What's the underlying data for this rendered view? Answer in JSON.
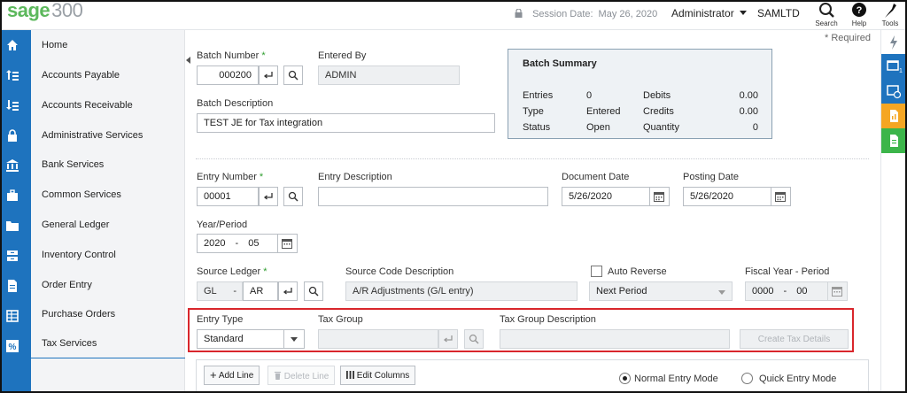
{
  "app": {
    "logo": "sage",
    "logo_version": "300"
  },
  "header": {
    "session_label": "Session Date:",
    "session_date": "May 26, 2020",
    "user": "Administrator",
    "company": "SAMLTD",
    "actions": [
      {
        "label": "Search",
        "icon": "search-icon"
      },
      {
        "label": "Help",
        "icon": "help-icon"
      },
      {
        "label": "Tools",
        "icon": "tools-icon"
      }
    ]
  },
  "sidebar": {
    "items": [
      {
        "label": "Home",
        "icon": "home-icon"
      },
      {
        "label": "Accounts Payable",
        "icon": "accounts-payable-icon"
      },
      {
        "label": "Accounts Receivable",
        "icon": "accounts-receivable-icon"
      },
      {
        "label": "Administrative Services",
        "icon": "lock-icon"
      },
      {
        "label": "Bank Services",
        "icon": "bank-icon"
      },
      {
        "label": "Common Services",
        "icon": "briefcase-icon"
      },
      {
        "label": "General Ledger",
        "icon": "folder-icon"
      },
      {
        "label": "Inventory Control",
        "icon": "inventory-icon"
      },
      {
        "label": "Order Entry",
        "icon": "document-icon"
      },
      {
        "label": "Purchase Orders",
        "icon": "grid-icon"
      },
      {
        "label": "Tax Services",
        "icon": "percent-icon"
      }
    ]
  },
  "form": {
    "required_note": "* Required",
    "batch_number": {
      "label": "Batch Number",
      "required": "*",
      "value": "000200"
    },
    "entered_by": {
      "label": "Entered By",
      "value": "ADMIN"
    },
    "batch_description": {
      "label": "Batch Description",
      "value": "TEST JE for Tax integration"
    },
    "entry_number": {
      "label": "Entry Number",
      "required": "*",
      "value": "00001"
    },
    "entry_description": {
      "label": "Entry Description",
      "value": ""
    },
    "document_date": {
      "label": "Document Date",
      "value": "5/26/2020"
    },
    "posting_date": {
      "label": "Posting Date",
      "value": "5/26/2020"
    },
    "year_period": {
      "label": "Year/Period",
      "year": "2020",
      "separator": "-",
      "period": "05"
    },
    "source_ledger": {
      "label": "Source Ledger",
      "required": "*",
      "ledger": "GL",
      "separator": "-",
      "type": "AR"
    },
    "source_code_description": {
      "label": "Source Code Description",
      "value": "A/R Adjustments (G/L entry)"
    },
    "auto_reverse": {
      "label": "Auto Reverse",
      "checked": false,
      "selected": "Next Period"
    },
    "fiscal_year_period": {
      "label": "Fiscal Year - Period",
      "year": "0000",
      "separator": "-",
      "period": "00"
    },
    "entry_type": {
      "label": "Entry Type",
      "selected": "Standard"
    },
    "tax_group": {
      "label": "Tax Group",
      "value": ""
    },
    "tax_group_description": {
      "label": "Tax Group Description",
      "value": ""
    },
    "create_tax_details": "Create Tax Details"
  },
  "batch_summary": {
    "title": "Batch Summary",
    "rows": [
      {
        "label": "Entries",
        "value": "0",
        "label2": "Debits",
        "value2": "0.00"
      },
      {
        "label": "Type",
        "value": "Entered",
        "label2": "Credits",
        "value2": "0.00"
      },
      {
        "label": "Status",
        "value": "Open",
        "label2": "Quantity",
        "value2": "0"
      }
    ]
  },
  "grid_toolbar": {
    "add_line": "Add Line",
    "delete_line": "Delete Line",
    "edit_columns": "Edit Columns",
    "mode_normal": "Normal Entry Mode",
    "mode_quick": "Quick Entry Mode",
    "selected_mode": "normal"
  },
  "colors": {
    "brand_green": "#5cb85c",
    "sidebar_blue": "#1e73be",
    "highlight_red": "#d9262c"
  }
}
